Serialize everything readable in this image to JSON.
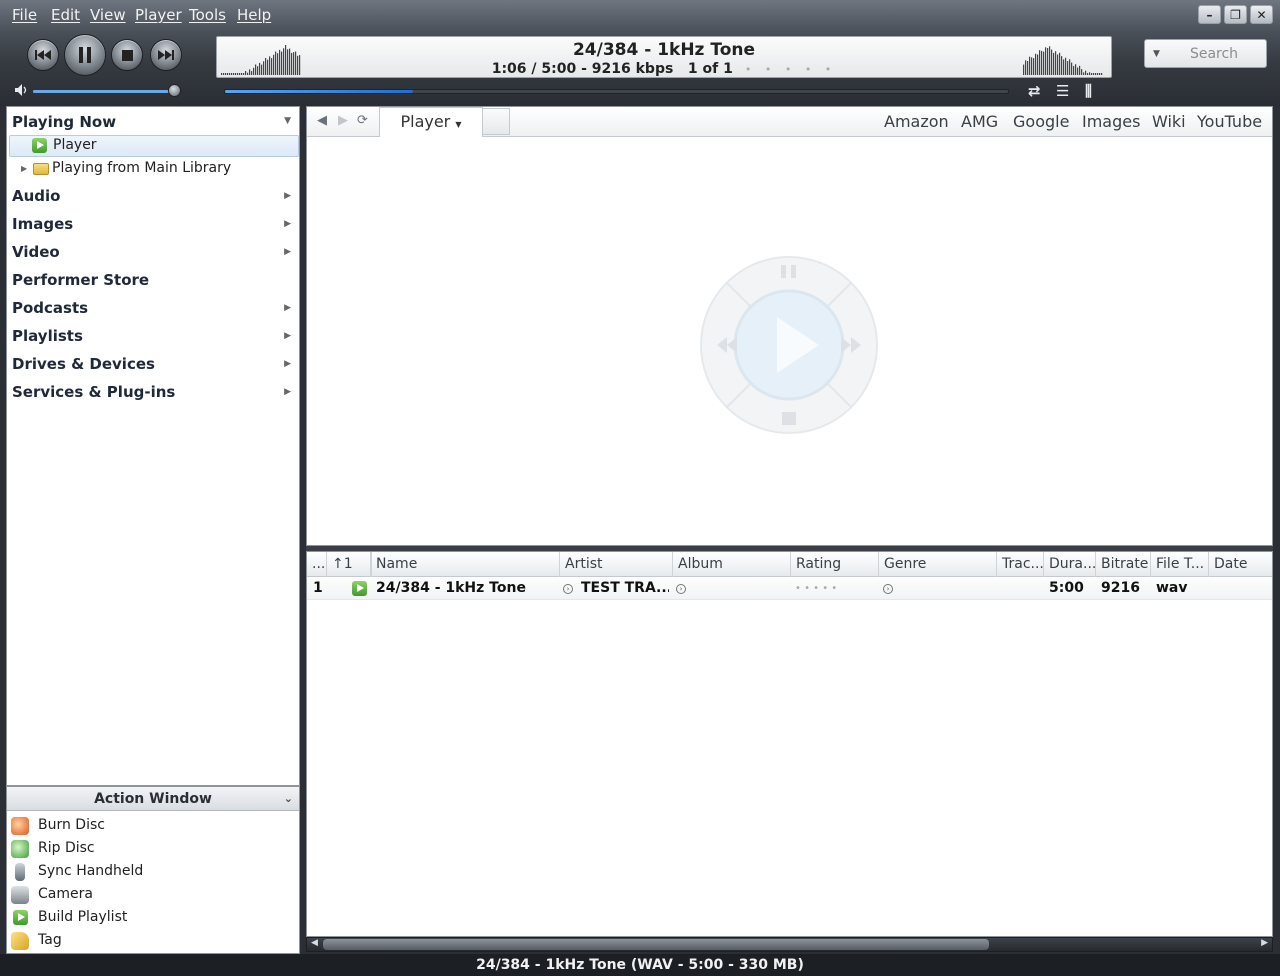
{
  "menu": [
    "File",
    "Edit",
    "View",
    "Player",
    "Tools",
    "Help"
  ],
  "now_playing": {
    "title": "24/384 - 1kHz Tone",
    "status": "1:06 / 5:00 - 9216 kbps   1 of 1",
    "rating_dots": "• • • • •",
    "progress": 0.24,
    "volume": 0.95
  },
  "search": {
    "placeholder": "Search"
  },
  "tree": {
    "playing_now": "Playing Now",
    "player": "Player",
    "playing_from": "Playing from Main Library",
    "sections": [
      "Audio",
      "Images",
      "Video",
      "Performer Store",
      "Podcasts",
      "Playlists",
      "Drives & Devices",
      "Services & Plug-ins"
    ]
  },
  "action_window": {
    "title": "Action Window",
    "items": [
      "Burn Disc",
      "Rip Disc",
      "Sync Handheld",
      "Camera",
      "Build Playlist",
      "Tag"
    ]
  },
  "view": {
    "player_tab": "Player",
    "links": [
      "Amazon",
      "AMG",
      "Google",
      "Images",
      "Wiki",
      "YouTube"
    ]
  },
  "list": {
    "columns": [
      "...",
      "↑1",
      "",
      "Name",
      "Artist",
      "Album",
      "Rating",
      "Genre",
      "Trac...",
      "Dura...",
      "Bitrate",
      "File T...",
      "Date"
    ],
    "row": {
      "index": "1",
      "name": "24/384 - 1kHz Tone",
      "artist": "TEST TRA...",
      "rating_dots": "• • • • •",
      "duration": "5:00",
      "bitrate": "9216",
      "file_type": "wav"
    }
  },
  "status_bar": "24/384 - 1kHz Tone (WAV - 5:00 - 330 MB)",
  "colors": {
    "accent": "#3b8fe8",
    "chrome": "#353a41"
  }
}
